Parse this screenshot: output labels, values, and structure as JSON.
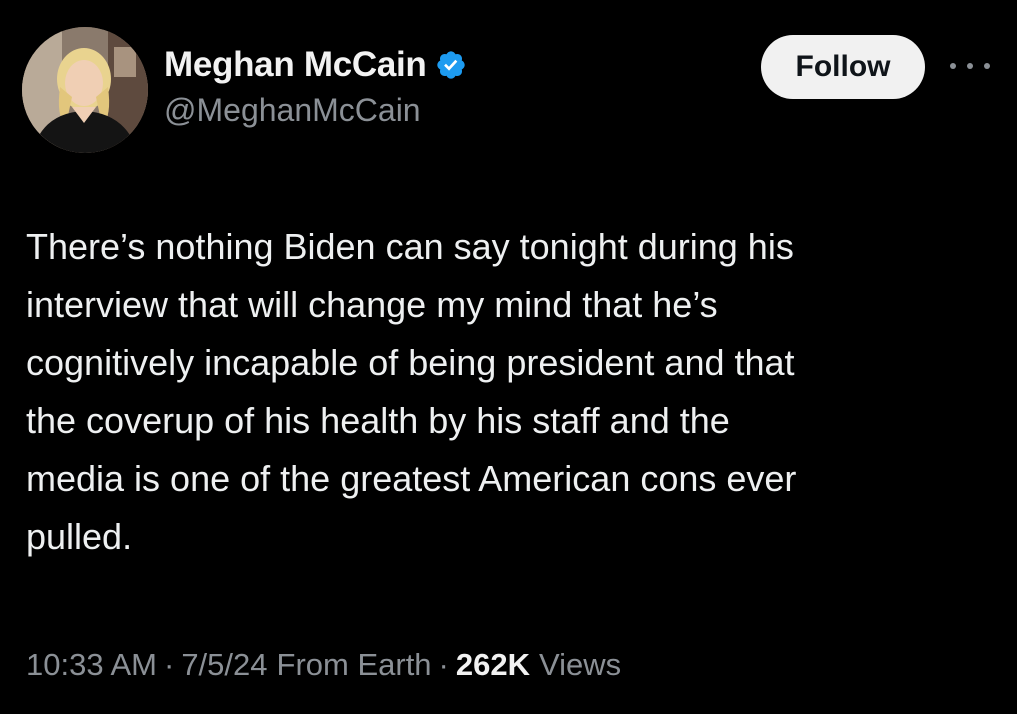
{
  "tweet": {
    "author": {
      "display_name": "Meghan McCain",
      "handle": "@MeghanMcCain",
      "verified": true,
      "verified_color": "#1d9bf0",
      "avatar_icon": "profile-photo"
    },
    "follow_label": "Follow",
    "more_icon": "ellipsis-icon",
    "text": "There’s nothing Biden can say tonight during his\ninterview that will change my mind that he’s\ncognitively incapable of being president and that\nthe coverup of his health by his staff and the\nmedia is one of the greatest American cons ever\npulled.",
    "meta": {
      "time": "10:33 AM",
      "separator": "·",
      "date": "7/5/24",
      "source": "From Earth",
      "views_count": "262K",
      "views_label": "Views"
    }
  },
  "colors": {
    "background": "#000000",
    "primary_text": "#e7e9ea",
    "secondary_text": "#8b9096",
    "follow_button_bg": "#f1f1f1"
  }
}
